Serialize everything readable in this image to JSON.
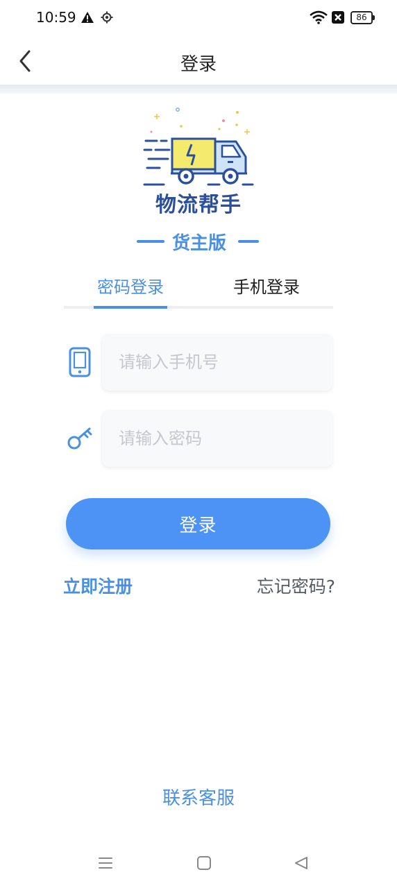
{
  "status_bar": {
    "time": "10:59",
    "battery_level": "86",
    "icons": [
      "warning-icon",
      "location-icon",
      "wifi-icon",
      "sim-blocked-icon",
      "battery-icon"
    ]
  },
  "header": {
    "title": "登录",
    "back_icon": "chevron-left-icon"
  },
  "brand": {
    "name": "物流帮手",
    "edition": "货主版",
    "logo_icon": "delivery-truck-icon"
  },
  "tabs": [
    {
      "label": "密码登录",
      "active": true
    },
    {
      "label": "手机登录",
      "active": false
    }
  ],
  "form": {
    "phone": {
      "placeholder": "请输入手机号",
      "value": "",
      "icon": "phone-icon"
    },
    "password": {
      "placeholder": "请输入密码",
      "value": "",
      "icon": "key-icon"
    },
    "submit_label": "登录"
  },
  "links": {
    "register": "立即注册",
    "forgot": "忘记密码?",
    "contact": "联系客服"
  },
  "colors": {
    "accent": "#4a90e2",
    "button": "#4c93f5",
    "brand_dark": "#2b4f9a",
    "truck_yellow": "#f3ea6e"
  },
  "nav_bar": [
    "menu-icon",
    "home-icon",
    "back-icon"
  ]
}
